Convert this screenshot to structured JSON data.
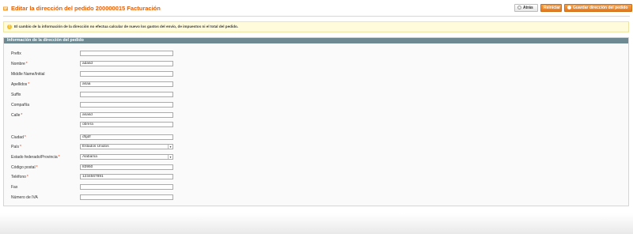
{
  "header": {
    "title": "Editar la dirección del pedido 200000015 Facturación",
    "title_icon": "address-icon",
    "buttons": {
      "back_label": "Atrás",
      "reset_label": "Reiniciar",
      "save_label": "Guardar dirección del pedido"
    }
  },
  "notice": {
    "icon": "warning-icon",
    "text": "El cambio de la información de la dirección no efectua calcular de nuevo los gastos del envío, de impuestos ni el total del pedido."
  },
  "panel": {
    "title": "Información de la dirección del pedido",
    "fields": {
      "prefix": {
        "label": "Prefix",
        "value": ""
      },
      "firstname": {
        "label": "Nombre",
        "required": "*",
        "value": "adasd"
      },
      "middlename": {
        "label": "Middle Name/Initial",
        "value": ""
      },
      "lastname": {
        "label": "Apellidos",
        "required": "*",
        "value": "asaa"
      },
      "suffix": {
        "label": "Suffix",
        "value": ""
      },
      "company": {
        "label": "Compañía",
        "value": ""
      },
      "street": {
        "label": "Calle",
        "required": "*",
        "line1": "asasd",
        "line2": "obrera"
      },
      "city": {
        "label": "Ciudad",
        "required": "*",
        "value": "dfgdf"
      },
      "country": {
        "label": "País",
        "required": "*",
        "value": "Estados Unidos"
      },
      "region": {
        "label": "Estado federado/Provincia",
        "required": "*",
        "value": "Alabama"
      },
      "postcode": {
        "label": "Código postal",
        "required": "*",
        "value": "83950"
      },
      "telephone": {
        "label": "Teléfono",
        "required": "*",
        "value": "1234567891"
      },
      "fax": {
        "label": "Fax",
        "value": ""
      },
      "vat": {
        "label": "Número de IVA",
        "value": ""
      }
    }
  },
  "colors": {
    "title": "#eb5e00",
    "accent_button": "#e3791b",
    "panel_header": "#6f8992",
    "notice_bg": "#fffbdb",
    "required": "#eb340a"
  }
}
